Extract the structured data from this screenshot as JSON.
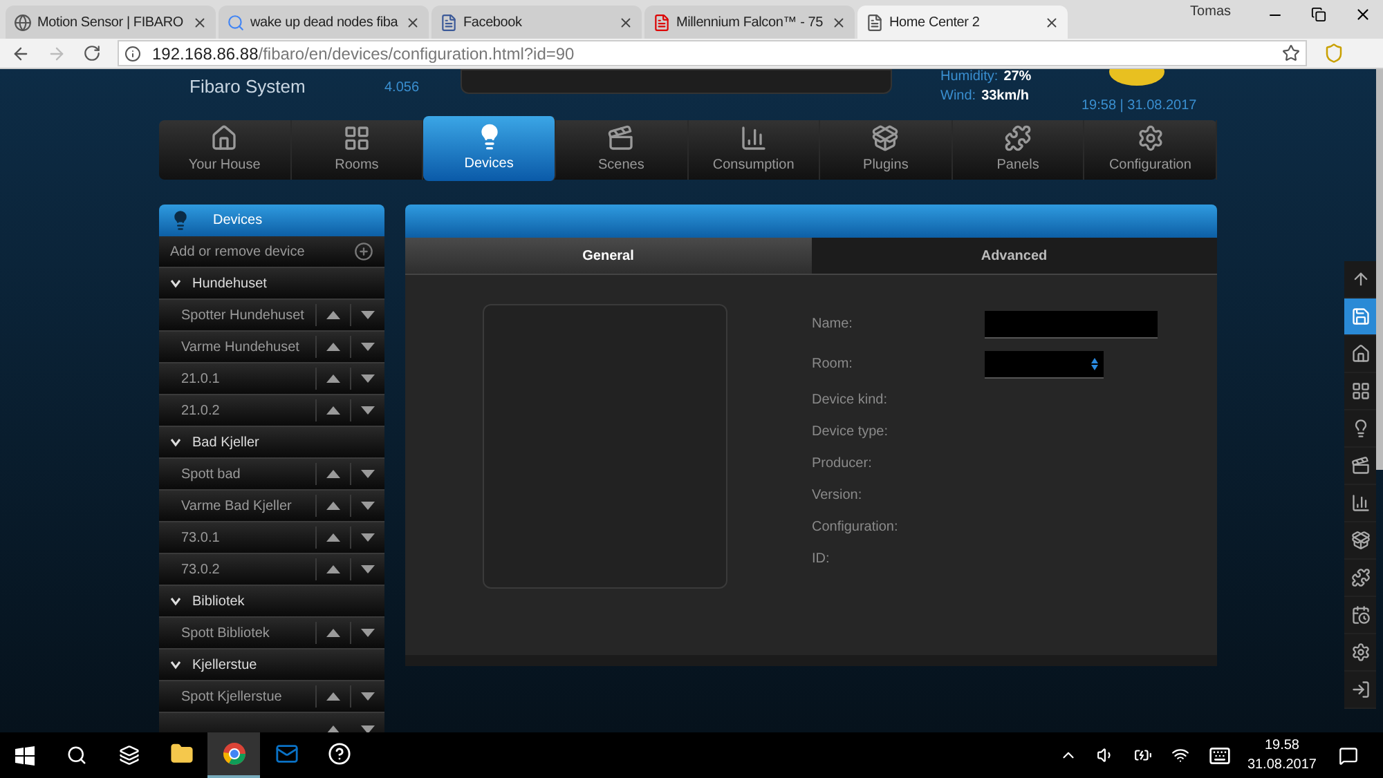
{
  "browser": {
    "tabs": [
      {
        "title": "Motion Sensor | FIBARO",
        "selected": false
      },
      {
        "title": "wake up dead nodes fiba",
        "selected": false
      },
      {
        "title": "Facebook",
        "selected": false
      },
      {
        "title": "Millennium Falcon™ - 75",
        "selected": false
      },
      {
        "title": "Home Center 2",
        "selected": true
      }
    ],
    "user": "Tomas",
    "url_host": "192.168.86.88",
    "url_path": "/fibaro/en/devices/configuration.html?id=90"
  },
  "header": {
    "brand": "Fibaro System",
    "version": "4.056",
    "humidity_label": "Humidity:",
    "humidity": "27%",
    "wind_label": "Wind:",
    "wind": "33km/h",
    "datetime": "19:58 | 31.08.2017"
  },
  "nav": [
    {
      "label": "Your House",
      "selected": false
    },
    {
      "label": "Rooms",
      "selected": false
    },
    {
      "label": "Devices",
      "selected": true
    },
    {
      "label": "Scenes",
      "selected": false
    },
    {
      "label": "Consumption",
      "selected": false
    },
    {
      "label": "Plugins",
      "selected": false
    },
    {
      "label": "Panels",
      "selected": false
    },
    {
      "label": "Configuration",
      "selected": false
    }
  ],
  "sidebar": {
    "title": "Devices",
    "items": [
      {
        "kind": "action",
        "label": "Add or remove device"
      },
      {
        "kind": "room",
        "label": "Hundehuset",
        "expanded": true
      },
      {
        "kind": "device",
        "label": "Spotter Hundehuset"
      },
      {
        "kind": "device",
        "label": "Varme Hundehuset"
      },
      {
        "kind": "device",
        "label": "21.0.1"
      },
      {
        "kind": "device",
        "label": "21.0.2"
      },
      {
        "kind": "room",
        "label": "Bad Kjeller",
        "expanded": true
      },
      {
        "kind": "device",
        "label": "Spott bad"
      },
      {
        "kind": "device",
        "label": "Varme Bad Kjeller"
      },
      {
        "kind": "device",
        "label": "73.0.1"
      },
      {
        "kind": "device",
        "label": "73.0.2"
      },
      {
        "kind": "room",
        "label": "Bibliotek",
        "expanded": true
      },
      {
        "kind": "device",
        "label": "Spott Bibliotek"
      },
      {
        "kind": "room",
        "label": "Kjellerstue",
        "expanded": true
      },
      {
        "kind": "device",
        "label": "Spott Kjellerstue"
      }
    ]
  },
  "panel": {
    "tabs": [
      {
        "label": "General",
        "selected": true
      },
      {
        "label": "Advanced",
        "selected": false
      }
    ],
    "fields": [
      {
        "kind": "text",
        "label": "Name:"
      },
      {
        "kind": "select",
        "label": "Room:"
      },
      {
        "kind": "info",
        "label": "Device kind:"
      },
      {
        "kind": "info",
        "label": "Device type:"
      },
      {
        "kind": "info",
        "label": "Producer:"
      },
      {
        "kind": "info",
        "label": "Version:"
      },
      {
        "kind": "info",
        "label": "Configuration:"
      },
      {
        "kind": "info",
        "label": "ID:"
      }
    ]
  },
  "toolbar": [
    {
      "selected": false
    },
    {
      "selected": true
    },
    {
      "selected": false
    },
    {
      "selected": false
    },
    {
      "selected": false
    },
    {
      "selected": false
    },
    {
      "selected": false
    },
    {
      "selected": false
    },
    {
      "selected": false
    },
    {
      "selected": false
    },
    {
      "selected": false
    },
    {
      "selected": false
    }
  ],
  "taskbar": {
    "apps": [
      {
        "active": false
      },
      {
        "active": true
      },
      {
        "active": false
      },
      {
        "active": false
      }
    ],
    "time": "19.58",
    "date": "31.08.2017"
  }
}
